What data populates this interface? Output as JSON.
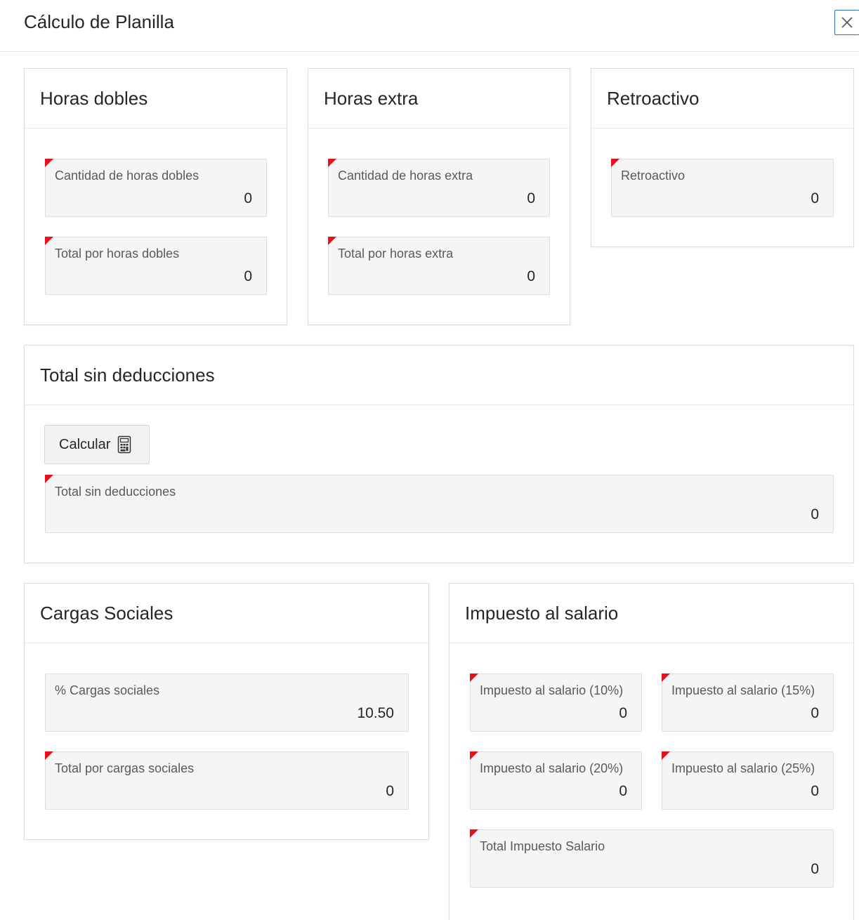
{
  "dialog": {
    "title": "Cálculo de Planilla",
    "close_icon": "close-icon"
  },
  "colors": {
    "required_flag": "#e8101b",
    "field_bg": "#f5f5f5",
    "close_border": "#2d6fb7"
  },
  "horas_dobles": {
    "title": "Horas dobles",
    "cantidad": {
      "label": "Cantidad de horas dobles",
      "value": "0"
    },
    "total": {
      "label": "Total por horas dobles",
      "value": "0"
    }
  },
  "horas_extra": {
    "title": "Horas extra",
    "cantidad": {
      "label": "Cantidad de horas extra",
      "value": "0"
    },
    "total": {
      "label": "Total por horas extra",
      "value": "0"
    }
  },
  "retroactivo": {
    "title": "Retroactivo",
    "field": {
      "label": "Retroactivo",
      "value": "0"
    }
  },
  "total_sin_deducciones": {
    "title": "Total sin deducciones",
    "button_label": "Calcular",
    "button_icon": "calculator-icon",
    "field": {
      "label": "Total sin deducciones",
      "value": "0"
    }
  },
  "cargas_sociales": {
    "title": "Cargas Sociales",
    "porcentaje": {
      "label": "% Cargas sociales",
      "value": "10.50"
    },
    "total": {
      "label": "Total por cargas sociales",
      "value": "0"
    }
  },
  "impuesto_salario": {
    "title": "Impuesto al salario",
    "p10": {
      "label": "Impuesto al salario (10%)",
      "value": "0"
    },
    "p15": {
      "label": "Impuesto al salario (15%)",
      "value": "0"
    },
    "p20": {
      "label": "Impuesto al salario (20%)",
      "value": "0"
    },
    "p25": {
      "label": "Impuesto al salario (25%)",
      "value": "0"
    },
    "total": {
      "label": "Total Impuesto Salario",
      "value": "0"
    }
  }
}
